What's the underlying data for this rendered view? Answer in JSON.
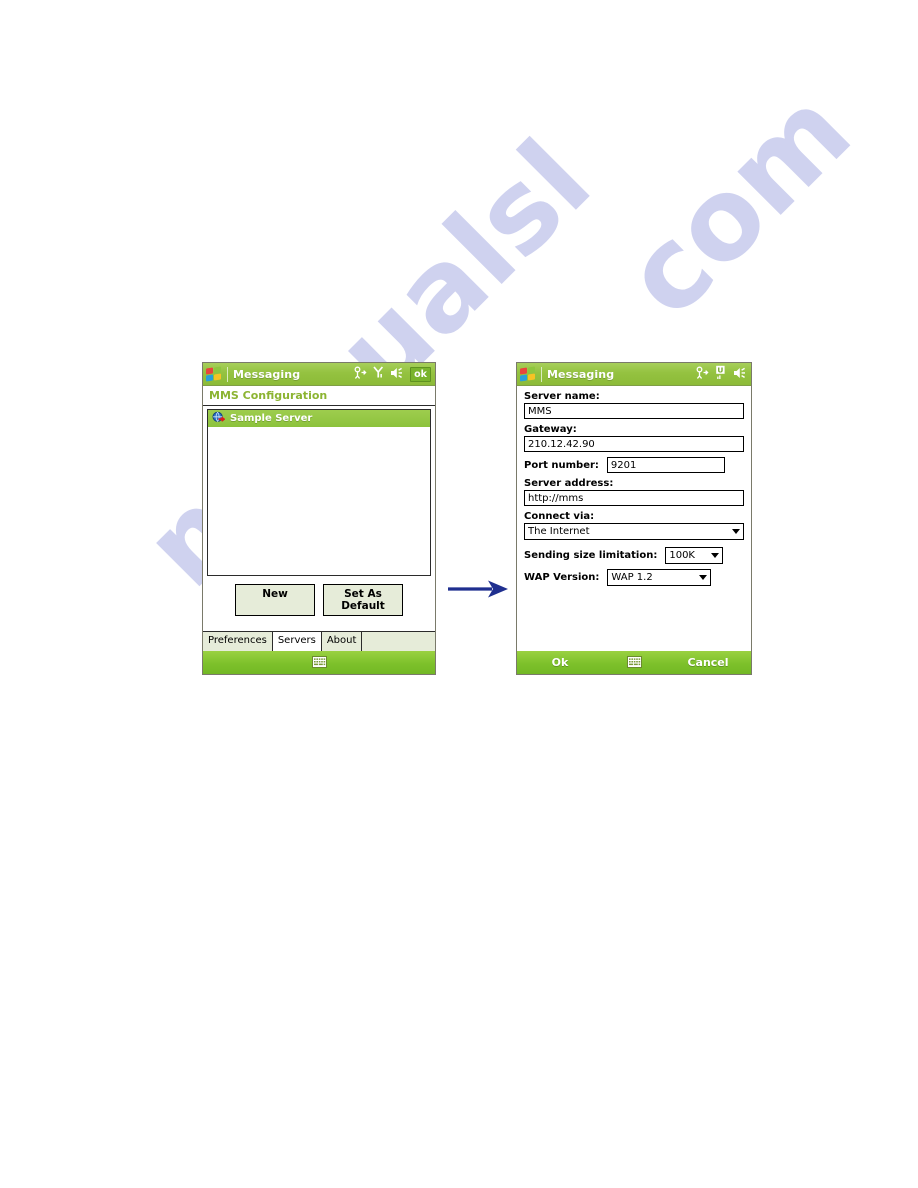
{
  "watermark": {
    "line1": "manualsl",
    "line2": "com"
  },
  "arrow": {
    "name": "flow-arrow",
    "color": "#1f2f8f",
    "direction": "right"
  },
  "left_screen": {
    "titlebar": {
      "app_title": "Messaging",
      "icons": [
        "connectivity-icon",
        "signal-icon",
        "volume-icon"
      ],
      "ok_label": "ok"
    },
    "subheader": "MMS Configuration",
    "list": {
      "items": [
        {
          "label": "Sample Server",
          "icon": "globe-arrow-icon",
          "selected": true
        }
      ]
    },
    "buttons": {
      "new_label": "New",
      "set_default_label": "Set As Default"
    },
    "tabs": [
      {
        "label": "Preferences",
        "active": false
      },
      {
        "label": "Servers",
        "active": true
      },
      {
        "label": "About",
        "active": false
      }
    ],
    "softbar": {
      "keyboard_icon": "soft-keyboard-icon"
    }
  },
  "right_screen": {
    "titlebar": {
      "app_title": "Messaging",
      "icons": [
        "connectivity-icon",
        "umts-signal-icon",
        "volume-icon"
      ]
    },
    "fields": [
      {
        "label": "Server name:",
        "value": "MMS",
        "type": "text"
      },
      {
        "label": "Gateway:",
        "value": "210.12.42.90",
        "type": "text"
      },
      {
        "label": "Port number:",
        "value": "9201",
        "type": "text-inline"
      },
      {
        "label": "Server address:",
        "value": "http://mms",
        "type": "text"
      },
      {
        "label": "Connect via:",
        "value": "The Internet",
        "type": "select"
      },
      {
        "label": "Sending size limitation:",
        "value": "100K",
        "type": "select-inline"
      },
      {
        "label": "WAP Version:",
        "value": "WAP 1.2",
        "type": "select-inline"
      }
    ],
    "softbar": {
      "ok_label": "Ok",
      "cancel_label": "Cancel",
      "keyboard_icon": "soft-keyboard-icon"
    }
  }
}
